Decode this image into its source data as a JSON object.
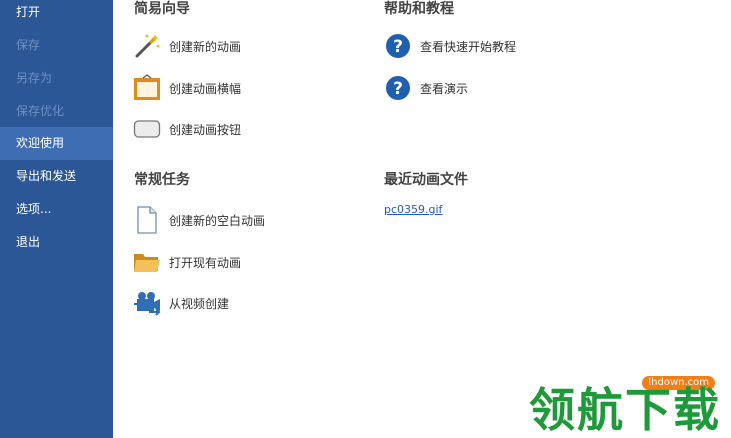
{
  "sidebar": {
    "items": [
      {
        "label": "打开",
        "state": "normal"
      },
      {
        "label": "保存",
        "state": "disabled"
      },
      {
        "label": "另存为",
        "state": "disabled"
      },
      {
        "label": "保存优化",
        "state": "disabled"
      },
      {
        "label": "欢迎使用",
        "state": "active"
      },
      {
        "label": "导出和发送",
        "state": "normal"
      },
      {
        "label": "选项...",
        "state": "normal"
      },
      {
        "label": "退出",
        "state": "normal"
      }
    ]
  },
  "wizard": {
    "title": "简易向导",
    "items": [
      {
        "label": "创建新的动画",
        "icon": "magic-wand-icon"
      },
      {
        "label": "创建动画横幅",
        "icon": "banner-frame-icon"
      },
      {
        "label": "创建动画按钮",
        "icon": "button-shape-icon"
      }
    ]
  },
  "tasks": {
    "title": "常规任务",
    "items": [
      {
        "label": "创建新的空白动画",
        "icon": "blank-document-icon"
      },
      {
        "label": "打开现有动画",
        "icon": "folder-icon"
      },
      {
        "label": "从视频创建",
        "icon": "video-camera-icon"
      }
    ]
  },
  "help": {
    "title": "帮助和教程",
    "items": [
      {
        "label": "查看快速开始教程",
        "icon": "help-circle-icon"
      },
      {
        "label": "查看演示",
        "icon": "help-circle-icon"
      }
    ]
  },
  "recent": {
    "title": "最近动画文件",
    "files": [
      "pc0359.gif"
    ]
  },
  "watermark": {
    "text": "领航下载",
    "url": "lhdown.com"
  },
  "colors": {
    "sidebar_bg": "#2b5797",
    "sidebar_active": "#3f6db3",
    "link": "#1f5fb0",
    "help_icon": "#1f5fb0",
    "watermark_green": "#1f9a3a",
    "watermark_orange": "#f07f1a"
  }
}
